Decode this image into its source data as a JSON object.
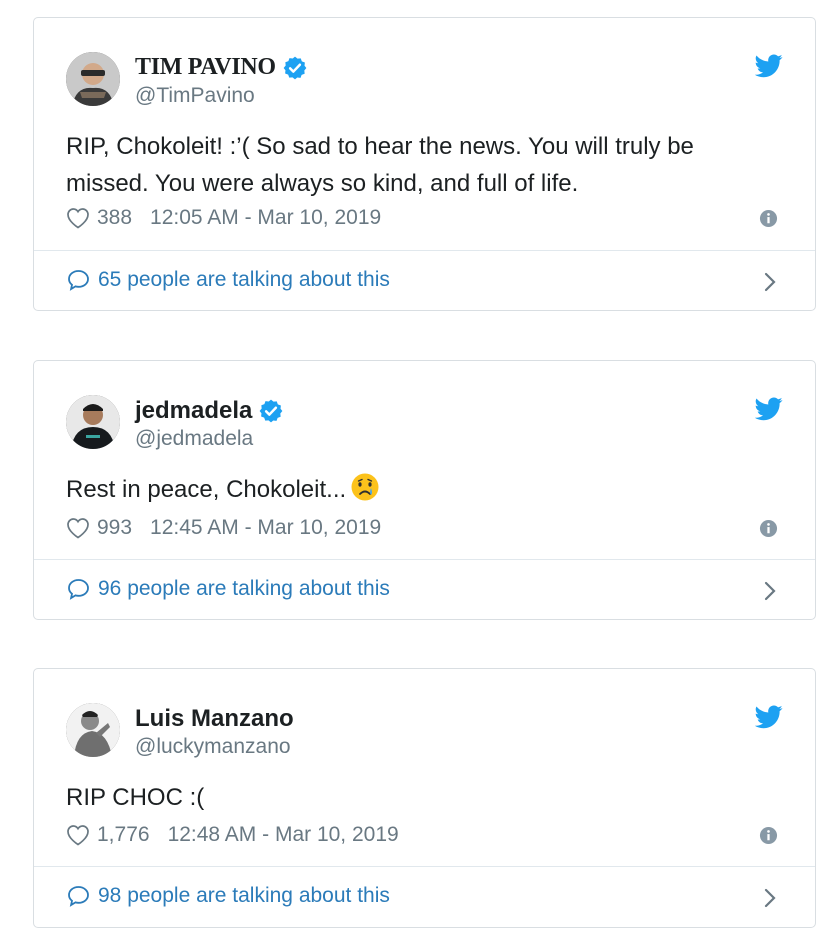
{
  "tweets": [
    {
      "display_name": "TIM PAVINO",
      "handle": "@TimPavino",
      "text": "RIP, Chokoleit! :’( So sad to hear the news. You will truly be missed. You were always so kind, and full of life.",
      "likes": "388",
      "timestamp": "12:05 AM - Mar 10, 2019",
      "talking": "65 people are talking about this",
      "verified": true
    },
    {
      "display_name": "jedmadela",
      "handle": "@jedmadela",
      "text": "Rest in peace, Chokoleit...",
      "likes": "993",
      "timestamp": "12:45 AM - Mar 10, 2019",
      "talking": "96 people are talking about this",
      "verified": true,
      "emoji": "crying-face"
    },
    {
      "display_name": "Luis Manzano",
      "handle": "@luckymanzano",
      "text": "RIP CHOC :(",
      "likes": "1,776",
      "timestamp": "12:48 AM - Mar 10, 2019",
      "talking": "98 people are talking about this",
      "verified": false
    }
  ],
  "colors": {
    "twitter_blue": "#1da1f2",
    "link_blue": "#2b7bb9",
    "muted_gray": "#697882",
    "border": "#d9dee2"
  },
  "icons": [
    "verified-badge-icon",
    "twitter-bird-icon",
    "heart-icon",
    "info-icon",
    "comment-bubble-icon",
    "chevron-right-icon"
  ]
}
